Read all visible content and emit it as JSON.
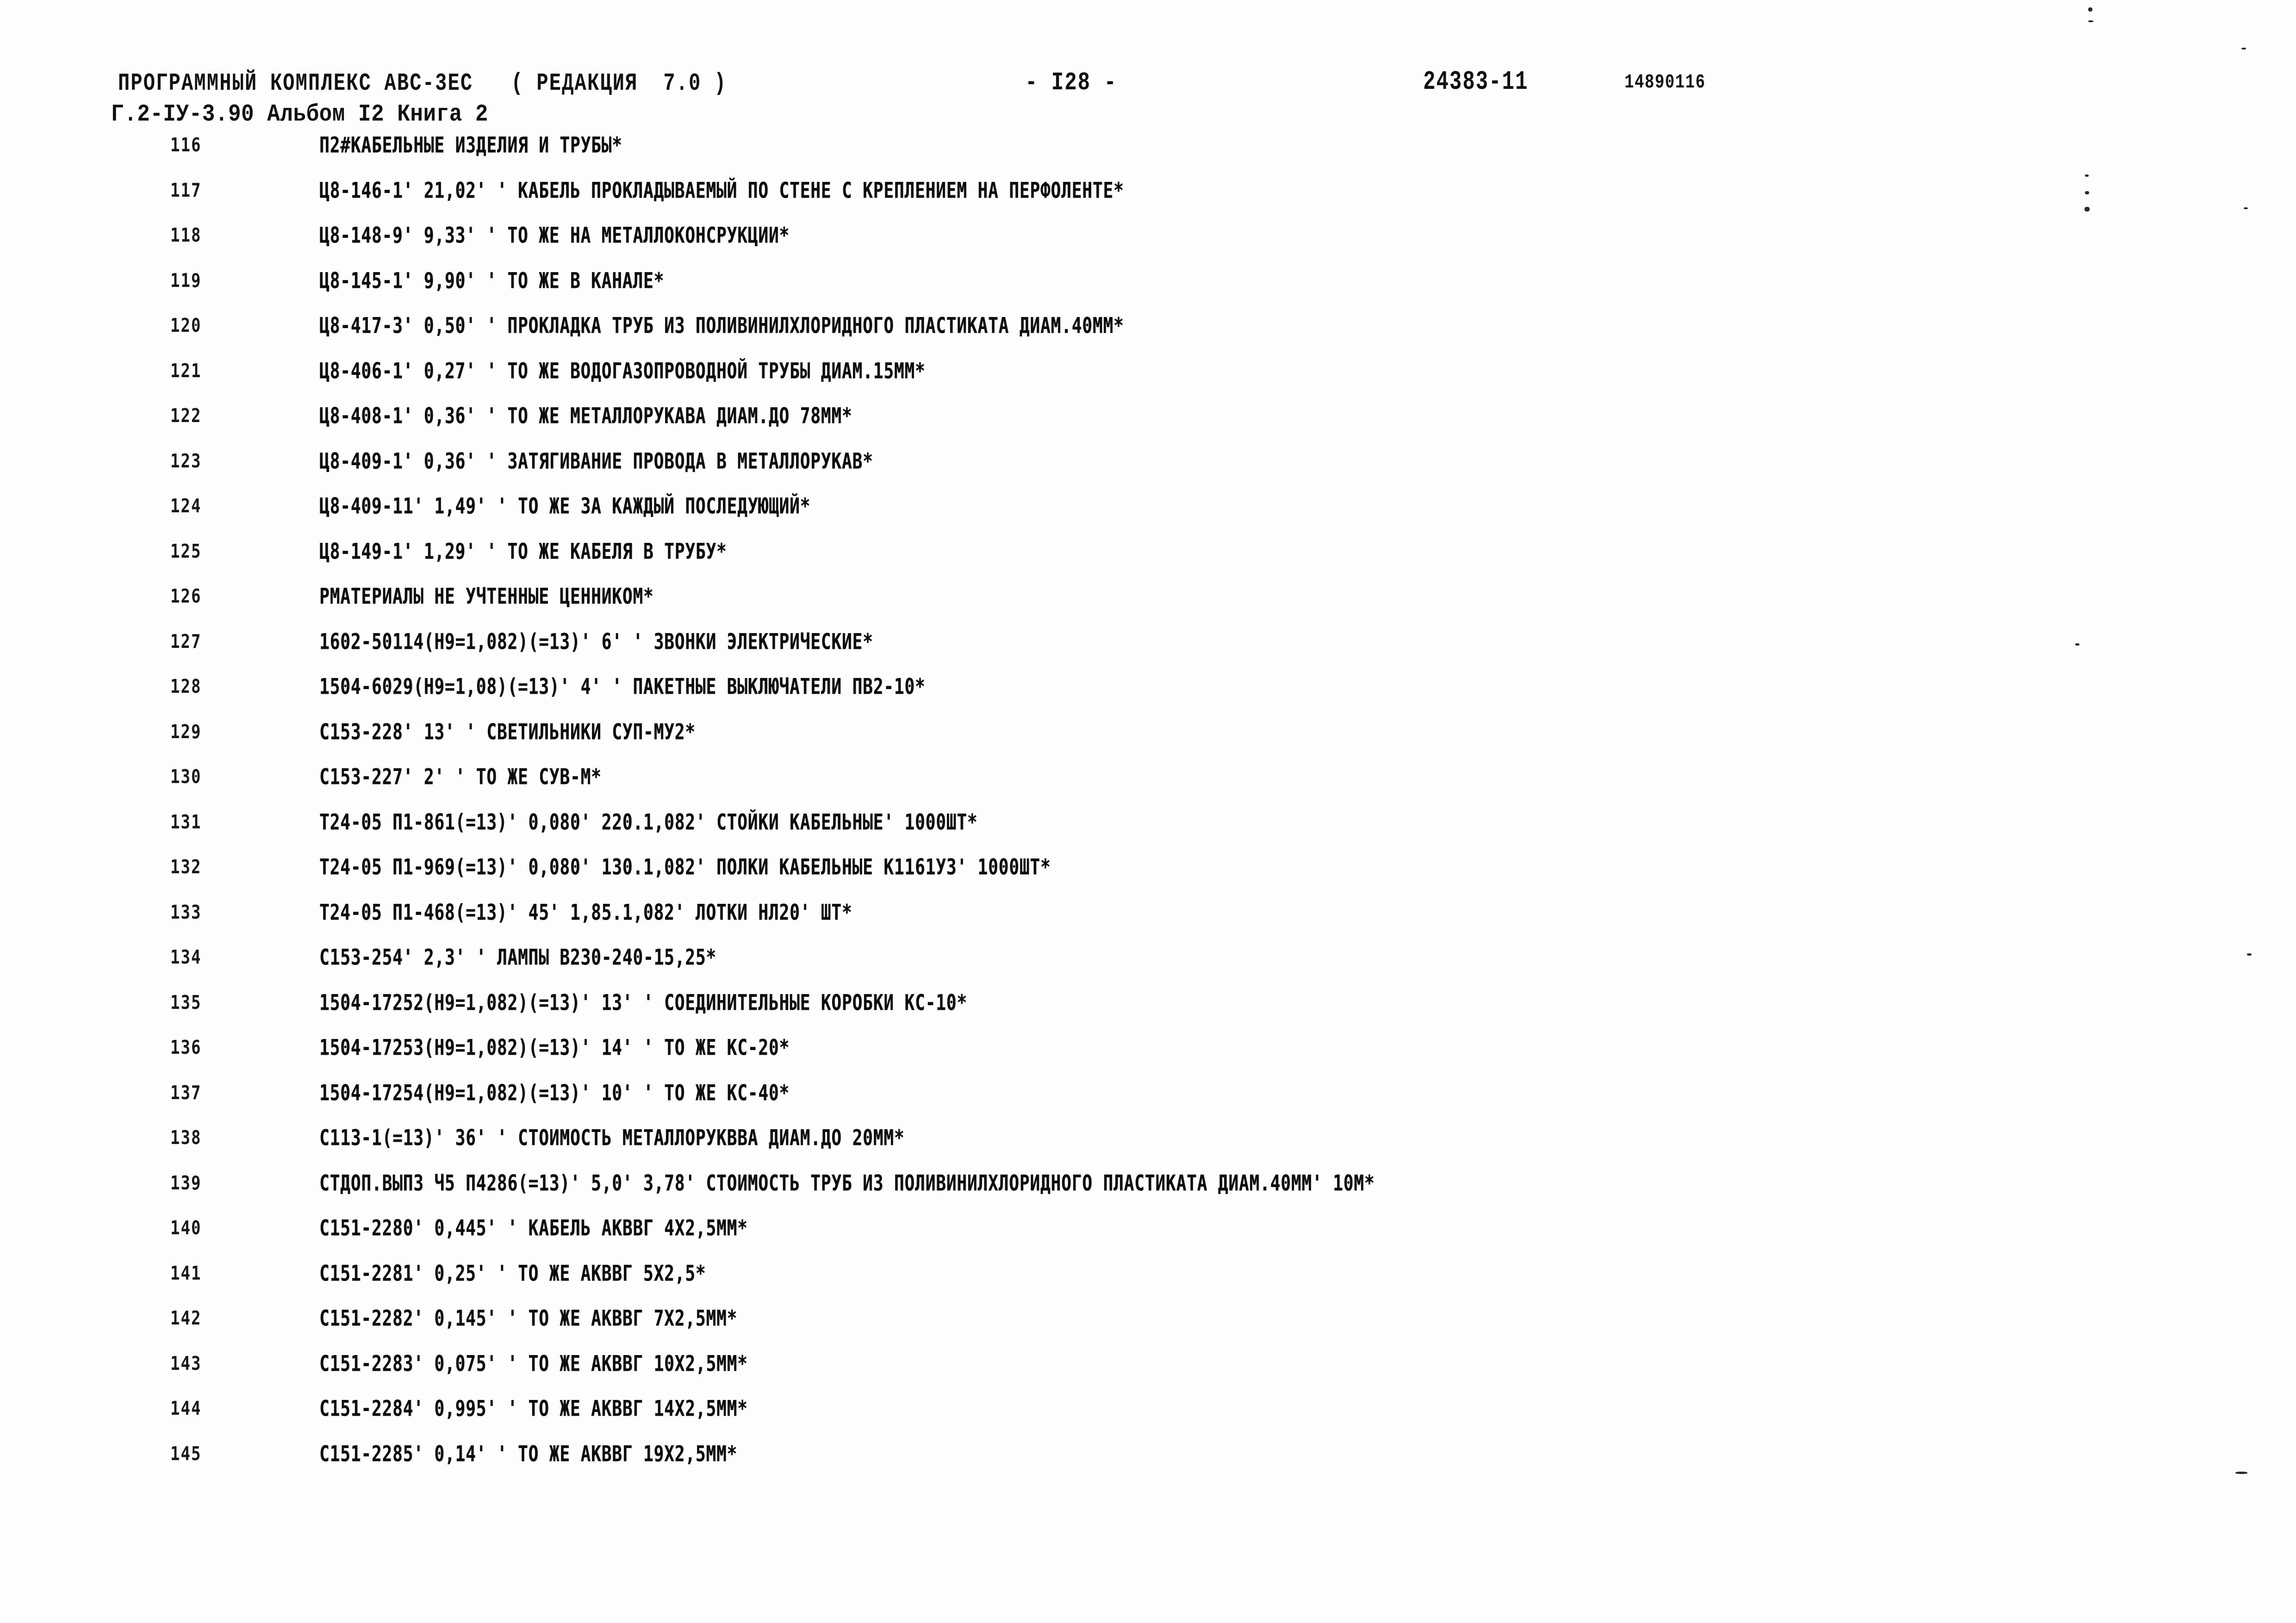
{
  "document": {
    "header": {
      "program_line": "ПРОГРАММНЫЙ КОМПЛЕКС АВС-3ЕС   ( РЕДАКЦИЯ  7.0 )",
      "page_marker": "- I28 -",
      "doc_code": "24383-11",
      "serial": "14890116",
      "album_line": "Г.2-IУ-3.90 Альбом I2 Книга 2"
    },
    "rows": [
      {
        "num": "116",
        "text": "П2#КАБЕЛЬНЫЕ ИЗДЕЛИЯ И ТРУБЫ*"
      },
      {
        "num": "117",
        "text": "Ц8-146-1' 21,02' ' КАБЕЛЬ ПРОКЛАДЫВАЕМЫЙ ПО СТЕНЕ С КРЕПЛЕНИЕМ НА ПЕРФОЛЕНТЕ*"
      },
      {
        "num": "118",
        "text": "Ц8-148-9' 9,33' ' ТО ЖЕ НА МЕТАЛЛОКОНСРУКЦИИ*"
      },
      {
        "num": "119",
        "text": "Ц8-145-1' 9,90' ' ТО ЖЕ В КАНАЛЕ*"
      },
      {
        "num": "120",
        "text": "Ц8-417-3' 0,50' ' ПРОКЛАДКА ТРУБ ИЗ ПОЛИВИНИЛХЛОРИДНОГО ПЛАСТИКАТА ДИАМ.40ММ*"
      },
      {
        "num": "121",
        "text": "Ц8-406-1' 0,27' ' ТО ЖЕ ВОДОГАЗОПРОВОДНОЙ ТРУБЫ ДИАМ.15ММ*"
      },
      {
        "num": "122",
        "text": "Ц8-408-1' 0,36' ' ТО ЖЕ МЕТАЛЛОРУКАВА ДИАМ.ДО 78ММ*"
      },
      {
        "num": "123",
        "text": "Ц8-409-1' 0,36' ' ЗАТЯГИВАНИЕ ПРОВОДА В МЕТАЛЛОРУКАВ*"
      },
      {
        "num": "124",
        "text": "Ц8-409-11' 1,49' ' ТО ЖЕ ЗА КАЖДЫЙ ПОСЛЕДУЮЩИЙ*"
      },
      {
        "num": "125",
        "text": "Ц8-149-1' 1,29' ' ТО ЖЕ КАБЕЛЯ В ТРУБУ*"
      },
      {
        "num": "126",
        "text": "РМАТЕРИАЛЫ НЕ УЧТЕННЫЕ ЦЕННИКОМ*"
      },
      {
        "num": "127",
        "text": "1602-50114(Н9=1,082)(=13)' 6' ' ЗВОНКИ ЭЛЕКТРИЧЕСКИЕ*"
      },
      {
        "num": "128",
        "text": "1504-6029(Н9=1,08)(=13)' 4' ' ПАКЕТНЫЕ ВЫКЛЮЧАТЕЛИ ПВ2-10*"
      },
      {
        "num": "129",
        "text": "С153-228' 13' ' СВЕТИЛЬНИКИ СУП-МУ2*"
      },
      {
        "num": "130",
        "text": "С153-227' 2' ' ТО ЖЕ СУВ-М*"
      },
      {
        "num": "131",
        "text": "Т24-05 П1-861(=13)' 0,080' 220.1,082' СТОЙКИ КАБЕЛЬНЫЕ' 1000ШТ*"
      },
      {
        "num": "132",
        "text": "Т24-05 П1-969(=13)' 0,080' 130.1,082' ПОЛКИ КАБЕЛЬНЫЕ К1161У3' 1000ШТ*"
      },
      {
        "num": "133",
        "text": "Т24-05 П1-468(=13)' 45' 1,85.1,082' ЛОТКИ НЛ20' ШТ*"
      },
      {
        "num": "134",
        "text": "С153-254' 2,3' ' ЛАМПЫ В230-240-15,25*"
      },
      {
        "num": "135",
        "text": "1504-17252(Н9=1,082)(=13)' 13' ' СОЕДИНИТЕЛЬНЫЕ КОРОБКИ КС-10*"
      },
      {
        "num": "136",
        "text": "1504-17253(Н9=1,082)(=13)' 14' ' ТО ЖЕ КС-20*"
      },
      {
        "num": "137",
        "text": "1504-17254(Н9=1,082)(=13)' 10' ' ТО ЖЕ КС-40*"
      },
      {
        "num": "138",
        "text": "С113-1(=13)' 36' ' СТОИМОСТЬ МЕТАЛЛОРУКВВА ДИАМ.ДО 20ММ*"
      },
      {
        "num": "139",
        "text": "СТДОП.ВЫП3 Ч5 П4286(=13)' 5,0' 3,78' СТОИМОСТЬ ТРУБ ИЗ ПОЛИВИНИЛХЛОРИДНОГО ПЛАСТИКАТА ДИАМ.40ММ' 10М*"
      },
      {
        "num": "140",
        "text": "С151-2280' 0,445' ' КАБЕЛЬ АКВВГ 4Х2,5ММ*"
      },
      {
        "num": "141",
        "text": "С151-2281' 0,25' ' ТО ЖЕ АКВВГ 5Х2,5*"
      },
      {
        "num": "142",
        "text": "С151-2282' 0,145' ' ТО ЖЕ АКВВГ 7Х2,5ММ*"
      },
      {
        "num": "143",
        "text": "С151-2283' 0,075' ' ТО ЖЕ АКВВГ 10Х2,5ММ*"
      },
      {
        "num": "144",
        "text": "С151-2284' 0,995' ' ТО ЖЕ АКВВГ 14Х2,5ММ*"
      },
      {
        "num": "145",
        "text": "С151-2285' 0,14' ' ТО ЖЕ АКВВГ 19Х2,5ММ*"
      }
    ]
  },
  "colors": {
    "ink": "#0d0d0d",
    "paper": "#fdfdfd"
  }
}
